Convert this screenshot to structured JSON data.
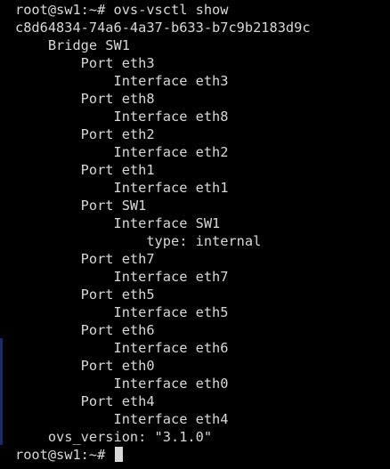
{
  "terminal": {
    "lines": [
      "root@sw1:~# ovs-vsctl show",
      "c8d64834-74a6-4a37-b633-b7c9b2183d9c",
      "    Bridge SW1",
      "        Port eth3",
      "            Interface eth3",
      "        Port eth8",
      "            Interface eth8",
      "        Port eth2",
      "            Interface eth2",
      "        Port eth1",
      "            Interface eth1",
      "        Port SW1",
      "            Interface SW1",
      "                type: internal",
      "        Port eth7",
      "            Interface eth7",
      "        Port eth5",
      "            Interface eth5",
      "        Port eth6",
      "            Interface eth6",
      "        Port eth0",
      "            Interface eth0",
      "        Port eth4",
      "            Interface eth4",
      "    ovs_version: \"3.1.0\""
    ],
    "prompt": "root@sw1:~# "
  },
  "colors": {
    "background": "#000000",
    "foreground": "#d8d8d8",
    "left_edge": "#1a2a6a"
  }
}
